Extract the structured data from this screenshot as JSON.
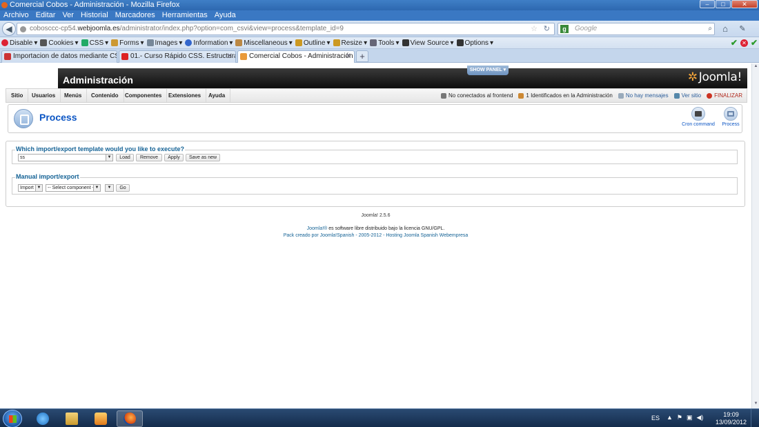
{
  "window": {
    "title": "Comercial Cobos - Administración - Mozilla Firefox",
    "controls": [
      "–",
      "□",
      "✕"
    ]
  },
  "menubar": [
    "Archivo",
    "Editar",
    "Ver",
    "Historial",
    "Marcadores",
    "Herramientas",
    "Ayuda"
  ],
  "urlbar": {
    "url_prefix": "cobosccc-cp54.",
    "url_domain": "webjoomla.es",
    "url_path": "/administrator/index.php?option=com_csvi&view=process&template_id=9",
    "search_placeholder": "Google"
  },
  "devbar": [
    {
      "label": "Disable",
      "color": "#d23"
    },
    {
      "label": "Cookies",
      "color": "#555"
    },
    {
      "label": "CSS",
      "color": "#2a6"
    },
    {
      "label": "Forms",
      "color": "#c93"
    },
    {
      "label": "Images",
      "color": "#789"
    },
    {
      "label": "Information",
      "color": "#36c"
    },
    {
      "label": "Miscellaneous",
      "color": "#b84"
    },
    {
      "label": "Outline",
      "color": "#c92"
    },
    {
      "label": "Resize",
      "color": "#c92"
    },
    {
      "label": "Tools",
      "color": "#667"
    },
    {
      "label": "View Source",
      "color": "#333"
    },
    {
      "label": "Options",
      "color": "#333"
    }
  ],
  "tabs": [
    {
      "label": "Importacion de datos mediante CSVI ...",
      "color": "#c33"
    },
    {
      "label": "01.- Curso Rápido CSS. Estructura - Y...",
      "color": "#d22"
    },
    {
      "label": "Comercial Cobos - Administración",
      "color": "#e99a3a"
    }
  ],
  "joomla": {
    "header_title": "Administración",
    "show_panel": "SHOW PANEL ▾",
    "logo_text": "Joomla!",
    "menu": [
      "Sitio",
      "Usuarios",
      "Menús",
      "Contenido",
      "Componentes",
      "Extensiones",
      "Ayuda"
    ],
    "status": {
      "frontend": "No conectados al frontend",
      "admins": "1 Identificados en la Administración",
      "messages": "No hay mensajes",
      "site": "Ver sitio",
      "logout": "FINALIZAR"
    },
    "page_title": "Process",
    "toolbar": {
      "cron": "Cron command",
      "process": "Process"
    },
    "template_section": {
      "legend": "Which import/export template would you like to execute?",
      "selected": "ss",
      "load": "Load",
      "remove": "Remove",
      "apply": "Apply",
      "save_as_new": "Save as new"
    },
    "manual_section": {
      "legend": "Manual import/export",
      "type_selected": "Import",
      "component_selected": "-- Select component --",
      "go": "Go"
    },
    "footer": {
      "version": "Joomla! 2.5.6",
      "license_link": "Joomla!®",
      "license_text": " es software libre distribuido bajo la licencia GNU/GPL.",
      "pack": "Pack creado por Joomla!Spanish - 2005-2012 - Hosting Joomla Spanish Webempresa"
    }
  },
  "taskbar": {
    "lang": "ES",
    "time": "19:09",
    "date": "13/09/2012"
  }
}
